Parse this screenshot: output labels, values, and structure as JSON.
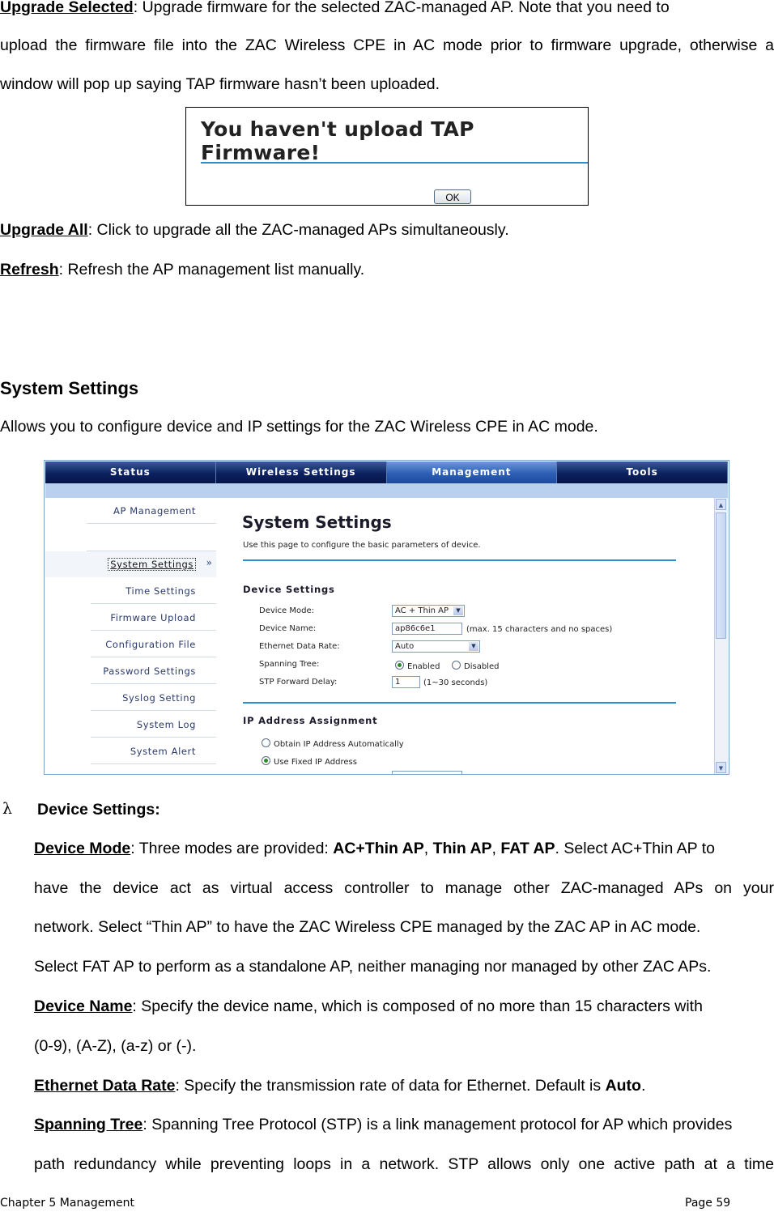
{
  "paragraphs": {
    "upgrade_selected_term": "Upgrade  Selected",
    "upgrade_selected_line1": ":  Upgrade  firmware  for  the  selected  ZAC-managed  AP.   Note  that  you  need  to",
    "upgrade_selected_line2": "upload the firmware file into the ZAC Wireless CPE in AC mode prior to firmware upgrade, otherwise a",
    "upgrade_selected_line3": "window will pop up saying TAP firmware hasn’t been uploaded.",
    "upgrade_all_term": "Upgrade All",
    "upgrade_all_text": ": Click to upgrade all the ZAC-managed APs simultaneously.",
    "refresh_term": "Refresh",
    "refresh_text": ": Refresh the AP management list manually.",
    "section_title": "System Settings",
    "section_intro": "Allows you to configure device and IP settings for the ZAC Wireless CPE in AC mode."
  },
  "dialog": {
    "message": "You haven't upload TAP Firmware!",
    "ok_label": "OK"
  },
  "screenshot": {
    "nav_tabs": [
      "Status",
      "Wireless Settings",
      "Management",
      "Tools"
    ],
    "active_tab": "Management",
    "sidebar": [
      "AP Management",
      "System Settings",
      "Time Settings",
      "Firmware Upload",
      "Configuration File",
      "Password Settings",
      "Syslog Setting",
      "System Log",
      "System Alert"
    ],
    "selected_item": "System Settings",
    "title": "System Settings",
    "subtitle": "Use this page to configure the basic parameters of device.",
    "device_settings_heading": "Device Settings",
    "device_mode_label": "Device Mode:",
    "device_mode_value": "AC + Thin AP",
    "device_name_label": "Device Name:",
    "device_name_value": "ap86c6e1",
    "device_name_note": "(max. 15 characters and no spaces)",
    "eth_rate_label": "Ethernet Data Rate:",
    "eth_rate_value": "Auto",
    "stp_label": "Spanning Tree:",
    "stp_enabled": "Enabled",
    "stp_disabled": "Disabled",
    "stp_delay_label": "STP Forward Delay:",
    "stp_delay_value": "1",
    "stp_delay_note": "(1~30 seconds)",
    "ip_heading": "IP Address Assignment",
    "ip_auto": "Obtain IP Address Automatically",
    "ip_fixed": "Use Fixed IP Address"
  },
  "device_settings": {
    "bullet": "λ",
    "heading": "Device Settings:",
    "mode_term": "Device Mode",
    "mode_t1": ": Three modes are provided: ",
    "mode_b1": "AC+Thin AP",
    "mode_sep1": ", ",
    "mode_b2": "Thin AP",
    "mode_sep2": ", ",
    "mode_b3": "FAT AP",
    "mode_t2": ".    Select AC+Thin AP to",
    "mode_line2": "have  the  device  act  as  virtual  access  controller  to  manage  other  ZAC-managed  APs  on  your",
    "mode_line3": "network.    Select “Thin AP” to have the ZAC Wireless CPE managed by the ZAC AP in AC mode.",
    "mode_line4": "Select FAT AP to perform as a standalone AP, neither managing nor managed by other ZAC APs.",
    "name_term": "Device Name",
    "name_line1": ": Specify the device name, which is composed of no more than 15 characters with",
    "name_line2": "(0-9), (A-Z), (a-z) or (-).",
    "eth_term": "Ethernet Data Rate",
    "eth_text": ": Specify the transmission rate of data for Ethernet.    Default is ",
    "eth_bold": "Auto",
    "eth_end": ".",
    "stp_term": "Spanning Tree",
    "stp_line1": ": Spanning Tree Protocol (STP) is a link management protocol for AP which provides",
    "stp_line2": "path redundancy while preventing loops in a network.   STP allows only one active path at a time"
  },
  "footer": {
    "chapter": "Chapter 5 Management",
    "page": "Page 59"
  }
}
